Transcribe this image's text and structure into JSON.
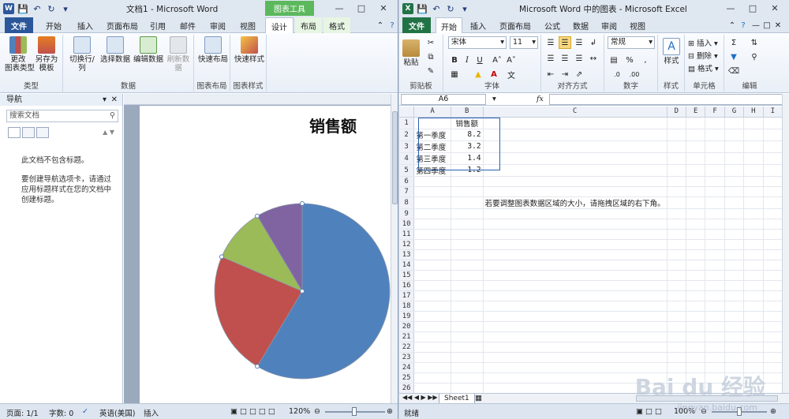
{
  "word": {
    "title": "文档1 - Microsoft Word",
    "context_tab_header": "图表工具",
    "tabs": [
      "文件",
      "开始",
      "插入",
      "页面布局",
      "引用",
      "邮件",
      "审阅",
      "视图",
      "设计",
      "布局",
      "格式"
    ],
    "ribbon": {
      "groups": [
        {
          "label": "类型",
          "buttons": [
            "更改\n图表类型",
            "另存为\n模板"
          ]
        },
        {
          "label": "数据",
          "buttons": [
            "切换行/列",
            "选择数据",
            "编辑数据",
            "刷新数据"
          ]
        },
        {
          "label": "图表布局",
          "buttons": [
            "快速布局"
          ]
        },
        {
          "label": "图表样式",
          "buttons": [
            "快速样式"
          ]
        }
      ]
    },
    "nav": {
      "title": "导航",
      "search_placeholder": "搜索文档",
      "no_headings": "此文档不包含标题。",
      "help_lines": [
        "要创建导航选项卡，请通过",
        "应用标题样式在您的文档中",
        "创建标题。"
      ]
    },
    "status": {
      "page": "页面: 1/1",
      "words": "字数: 0",
      "lang": "英语(美国)",
      "mode": "插入",
      "zoom": "120%"
    }
  },
  "chart_data": {
    "type": "pie",
    "title": "销售额",
    "categories": [
      "第一季度",
      "第二季度",
      "第三季度",
      "第四季度"
    ],
    "values": [
      8.2,
      3.2,
      1.4,
      1.2
    ],
    "colors": [
      "#4f81bd",
      "#c0504d",
      "#9bbb59",
      "#8064a2"
    ]
  },
  "excel": {
    "title": "Microsoft Word 中的图表 - Microsoft Excel",
    "tabs": [
      "文件",
      "开始",
      "插入",
      "页面布局",
      "公式",
      "数据",
      "审阅",
      "视图"
    ],
    "ribbon": {
      "font_name": "宋体",
      "font_size": "11",
      "number_format": "常规",
      "groups": [
        "剪贴板",
        "字体",
        "对齐方式",
        "数字",
        "样式",
        "单元格",
        "编辑"
      ],
      "paste_label": "粘贴",
      "style_label": "样式",
      "insert_label": "插入",
      "delete_label": "删除",
      "format_label": "格式"
    },
    "name_box": "A6",
    "fx": "fx",
    "columns": [
      "A",
      "B",
      "C",
      "D",
      "E",
      "F",
      "G",
      "H",
      "I"
    ],
    "rows": [
      [
        "",
        "销售额"
      ],
      [
        "第一季度",
        "8.2"
      ],
      [
        "第二季度",
        "3.2"
      ],
      [
        "第三季度",
        "1.4"
      ],
      [
        "第四季度",
        "1.2"
      ],
      [
        "",
        ""
      ],
      [
        "",
        ""
      ],
      [
        "",
        "",
        "若要调整图表数据区域的大小，请拖拽区域的右下角。"
      ]
    ],
    "total_rows": 26,
    "sheet_tab": "Sheet1",
    "status": {
      "ready": "就绪",
      "zoom": "100%"
    }
  },
  "watermark": {
    "logo": "Bai du 经验",
    "url": "jingyan.baidu.com"
  }
}
